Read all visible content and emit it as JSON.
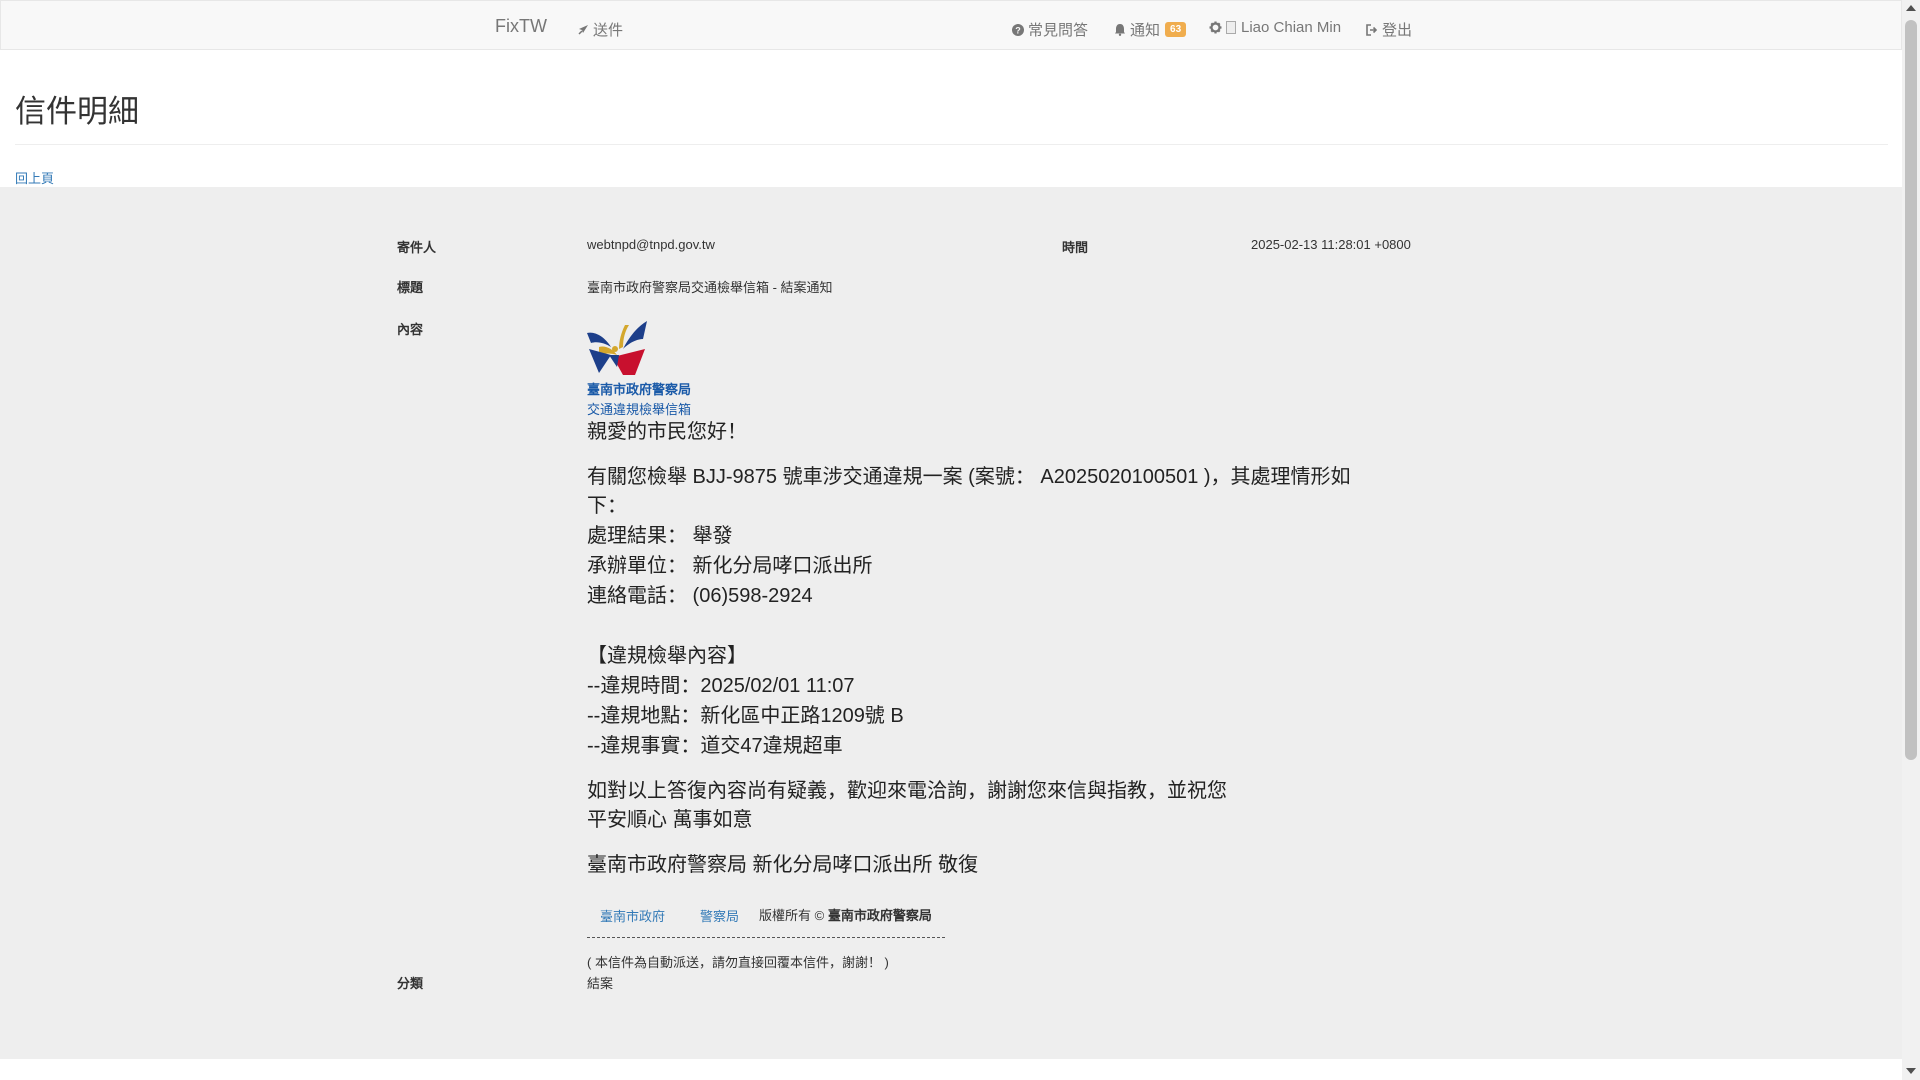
{
  "navbar": {
    "brand": "FixTW",
    "send": "送件",
    "faq": "常見問答",
    "notify": "通知",
    "notify_count": "63",
    "user": "Liao Chian Min",
    "logout": "登出",
    "icons": [
      "rocket-icon",
      "question-circle-icon",
      "bell-icon",
      "gear-icon",
      "sign-out-icon"
    ]
  },
  "page": {
    "title": "信件明細",
    "back": "回上頁"
  },
  "mail": {
    "sender_label": "寄件人",
    "sender": "webtnpd@tnpd.gov.tw",
    "time_label": "時間",
    "time": "2025-02-13 11:28:01 +0800",
    "subject_label": "標題",
    "subject": "臺南市政府警察局交通檢舉信箱 - 結案通知",
    "content_label": "內容",
    "category_label": "分類",
    "category": "結案"
  },
  "letter": {
    "dept_name": "臺南市政府警察局",
    "dept_sub": "交通違規檢舉信箱",
    "greeting": "親愛的市民您好！",
    "intro_1": "有關您檢舉 BJJ-9875 號車涉交通違規一案 (案號： A2025020100501 )，其處理情形如",
    "intro_2": "下：",
    "result": "處理結果： 舉發",
    "unit": "承辦單位： 新化分局哮口派出所",
    "phone": "連絡電話： (06)598-2924",
    "section_title": "【違規檢舉內容】",
    "v_time": "--違規時間：2025/02/01 11:07",
    "v_place": "--違規地點：新化區中正路1209號 B",
    "v_fact": "--違規事實：道交47違規超車",
    "closing_1": "如對以上答復內容尚有疑義，歡迎來電洽詢，謝謝您來信與指教，並祝您",
    "closing_2": "平安順心 萬事如意",
    "signature": "臺南市政府警察局 新化分局哮口派出所 敬復",
    "footer_link1": "臺南市政府",
    "footer_link2": "警察局",
    "rights_prefix": "版權所有 ©",
    "rights_owner": "臺南市政府警察局",
    "auto_note": "( 本信件為自動派送，請勿直接回覆本信件，謝謝！ )"
  },
  "colors": {
    "link": "#337ab7",
    "badge": "#f0ad4e",
    "dept": "#1a5aa8",
    "content_bg": "#eeeeee",
    "navbar_bg": "#f8f8f8"
  }
}
